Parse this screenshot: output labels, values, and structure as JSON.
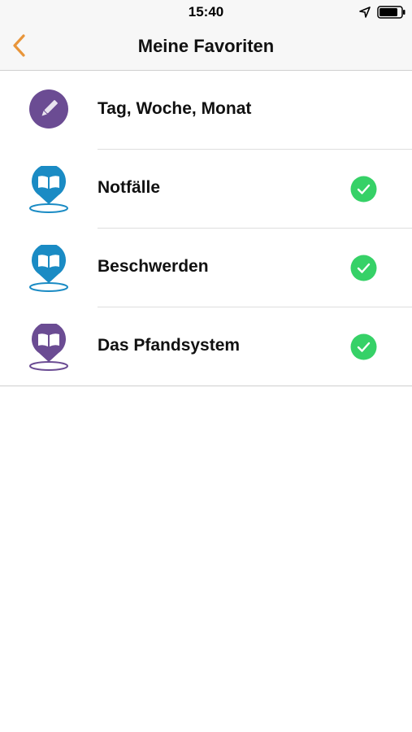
{
  "status_bar": {
    "time": "15:40"
  },
  "nav": {
    "title": "Meine Favoriten"
  },
  "colors": {
    "accent": "#e8953a",
    "purple": "#6b4c93",
    "blue": "#1a8bc4",
    "check_green": "#36d167"
  },
  "items": [
    {
      "label": "Tag, Woche, Monat",
      "icon": "pencil-circle-icon",
      "checked": false
    },
    {
      "label": "Notfälle",
      "icon": "book-pin-icon-blue",
      "checked": true
    },
    {
      "label": "Beschwerden",
      "icon": "book-pin-icon-blue",
      "checked": true
    },
    {
      "label": "Das Pfandsystem",
      "icon": "book-pin-icon-purple",
      "checked": true
    }
  ]
}
